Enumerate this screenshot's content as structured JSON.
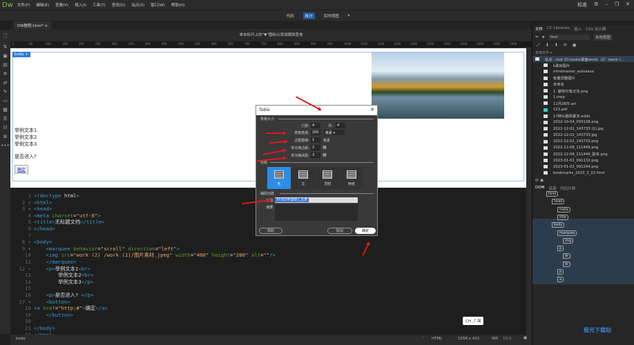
{
  "app": {
    "logo": "Dw",
    "menus": [
      "文件(F)",
      "编辑(E)",
      "查看(V)",
      "插入(I)",
      "工具(T)",
      "查找(D)",
      "站点(S)",
      "窗口(W)",
      "帮助(H)"
    ],
    "workspace": "标准"
  },
  "views": {
    "code": "代码",
    "split": "拆分",
    "live": "实时视图"
  },
  "document_tab": "DW教程.html*",
  "infobar": "单击标尺上的\"▼\"图标以添加媒体查询",
  "ruler": [
    "0",
    "50",
    "100",
    "150",
    "200",
    "250",
    "300",
    "350",
    "400",
    "450",
    "500",
    "550",
    "600",
    "650",
    "700",
    "750",
    "800",
    "850",
    "900",
    "950",
    "1000",
    "1050",
    "1100",
    "1150",
    "1200",
    "1250",
    "1300",
    "1350",
    "1400",
    "1450",
    "1500"
  ],
  "design": {
    "body_tag": "body",
    "lines": [
      "举例文本1",
      "举例文本2",
      "举例文本3"
    ],
    "question": "是否进入?",
    "button": "确定"
  },
  "code_lines": [
    "<!doctype html>",
    "<html>",
    "<head>",
    "<meta charset=\"utf-8\">",
    "<title>无标题文档</title>",
    "</head>",
    "",
    "<body>",
    "    <marquee behavior=\"scroll\" direction=\"left\">",
    "    <img src=\"work (2) /work (1)/图片素材.jpeg\" width=\"400\" height=\"200\" alt=\"\"/>",
    "    </marquee>",
    "    <p>举例文本1<br>",
    "        举例文本2<br>",
    "        举例文本3</p>",
    "",
    "    <p>是否进入? </p>",
    "    <button>",
    "<a href=\"http:#\">确定</a>",
    "    </button>",
    "",
    "</body>",
    "</html>"
  ],
  "status": {
    "tag": "body",
    "language": "HTML",
    "size": "1558 x 422",
    "mode": "INS",
    "position": "15:5"
  },
  "ime": "CH ⤴ 简",
  "watermark": "极光下载站 www.xz7.com",
  "files_panel": {
    "tabs": [
      "文件",
      "CC Libraries",
      "插入",
      "CSS 设计器"
    ],
    "site": "test",
    "view": "本地视图",
    "local_label": "本地文件 ▾",
    "root": "站点 - test (D:\\tools\\桌面\\work（2）\\work (...",
    "items": [
      {
        "name": "k歌出图片",
        "type": "folder"
      },
      {
        "name": "mindmaster_autosave",
        "type": "folder"
      },
      {
        "name": "批量调整图片",
        "type": "folder"
      },
      {
        "name": "未命名",
        "type": "folder"
      },
      {
        "name": "1. 康奈尔笔记法.png",
        "type": "image"
      },
      {
        "name": "1.mep",
        "type": "file"
      },
      {
        "name": "11月28日.art",
        "type": "file"
      },
      {
        "name": "123.pdf",
        "type": "pdf"
      },
      {
        "name": "17种头脑风暴法.eddx",
        "type": "file"
      },
      {
        "name": "2022-10-04_093128.png",
        "type": "image"
      },
      {
        "name": "2022-12-02_143733 (2).jpg",
        "type": "image"
      },
      {
        "name": "2022-12-02_143733.jpg",
        "type": "image"
      },
      {
        "name": "2022-12-02_143733.png",
        "type": "image"
      },
      {
        "name": "2022-12-08_111449.png",
        "type": "image"
      },
      {
        "name": "2022-12-08_111449_副本.png",
        "type": "image"
      },
      {
        "name": "2023-01-02_091132.png",
        "type": "image"
      },
      {
        "name": "2023-01-02_091244.png",
        "type": "image"
      },
      {
        "name": "bookmarks_2023_3_22.html",
        "type": "code"
      }
    ]
  },
  "dom_panel": {
    "tabs": [
      "DOM",
      "资源",
      "代码片断"
    ],
    "nodes": [
      "html",
      "head",
      "meta",
      "title",
      "body",
      "marquee",
      "img",
      "p",
      "br",
      "br",
      "p",
      "a"
    ]
  },
  "dialog": {
    "title": "Table",
    "section_size": "表格大小",
    "rows_label": "行数:",
    "rows": "4",
    "cols_label": "列:",
    "cols": "4",
    "width_label": "表格宽度:",
    "width": "200",
    "width_unit": "像素",
    "border_label": "边框粗细:",
    "border": "1",
    "border_unit": "像素",
    "padding_label": "单元格边距:",
    "padding": "2",
    "spacing_label": "单元格间距:",
    "spacing": "3",
    "section_header": "标题",
    "headers": [
      "无",
      "左",
      "顶部",
      "两者"
    ],
    "selected_header": "无",
    "section_access": "辅助功能",
    "caption_label": "标题:",
    "caption": "XXX同学成绩汇总表",
    "summary_label": "摘要:",
    "summary": "",
    "help": "帮助",
    "cancel": "取消",
    "ok": "确定"
  },
  "colors": {
    "accent": "#2d8ce6",
    "arrow": "#e0191c",
    "bg": "#1f1f1f"
  }
}
